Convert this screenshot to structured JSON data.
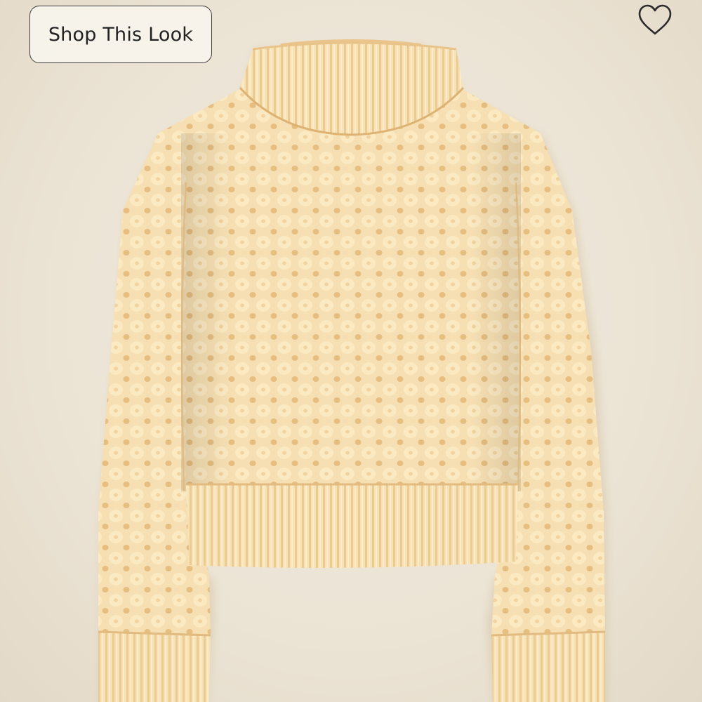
{
  "product_image": {
    "subject": "sweater-image",
    "colors": {
      "background": "#ede6d9",
      "knit_base": "#f6dfb2",
      "knit_shadow": "#e7c184",
      "knit_highlight": "#fbecc8"
    }
  },
  "actions": {
    "shop_label": "Shop This Look",
    "favorite_icon": "heart-icon"
  }
}
